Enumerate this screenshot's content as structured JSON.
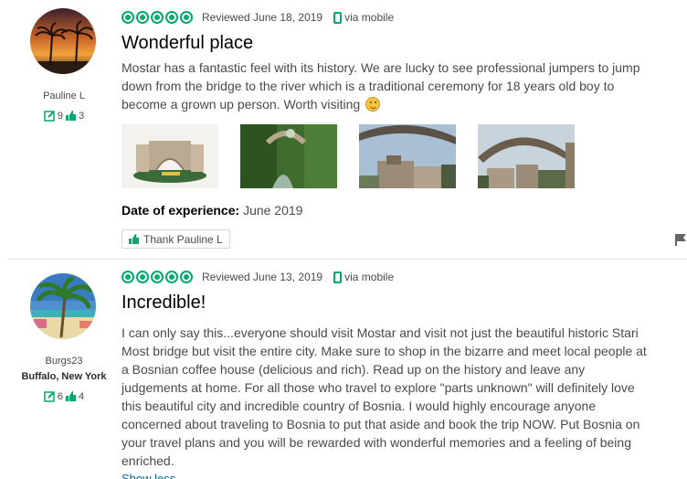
{
  "colors": {
    "bubble_green": "#00aa6c",
    "thumb_green": "#00aa6c",
    "text": "#4a4a4a",
    "title": "#000000",
    "link": "#006699"
  },
  "reviews": [
    {
      "user": {
        "name": "Pauline L",
        "hometown": "",
        "contributions": "9",
        "helpful_votes": "3",
        "avatar": "sunset-palm-trees-avatar"
      },
      "rating": 5,
      "reviewed_date": "Reviewed June 18, 2019",
      "via": "via mobile",
      "title": "Wonderful place",
      "body": "Mostar has a fantastic feel with its history. We are lucky to see professional jumpers to jump down from the bridge to the river which is a traditional ceremony for 18 years old boy to become a grown up person. Worth visiting",
      "photos": [
        "mostar-souvenir-photo",
        "bridge-river-photo",
        "old-bridge-sky-photo",
        "old-bridge-town-photo"
      ],
      "experience_label": "Date of experience:",
      "experience_value": "June 2019",
      "thank_label": "Thank Pauline L"
    },
    {
      "user": {
        "name": "Burgs23",
        "hometown": "Buffalo, New York",
        "contributions": "6",
        "helpful_votes": "4",
        "avatar": "beach-palm-trees-avatar"
      },
      "rating": 5,
      "reviewed_date": "Reviewed June 13, 2019",
      "via": "via mobile",
      "title": "Incredible!",
      "body": "I can only say this...everyone should visit Mostar and visit not just the beautiful historic Stari Most bridge but visit the entire city. Make sure to shop in the bizarre and meet local people at a Bosnian coffee house (delicious and rich). Read up on the history and leave any judgements at home. For all those who travel to explore \"parts unknown\" will definitely love this beautiful city and incredible country of Bosnia. I would highly encourage anyone concerned about traveling to Bosnia to put that aside and book the trip NOW. Put Bosnia on your travel plans and you will be rewarded with wonderful memories and a feeling of being enriched.",
      "show_less": "Show less"
    }
  ]
}
